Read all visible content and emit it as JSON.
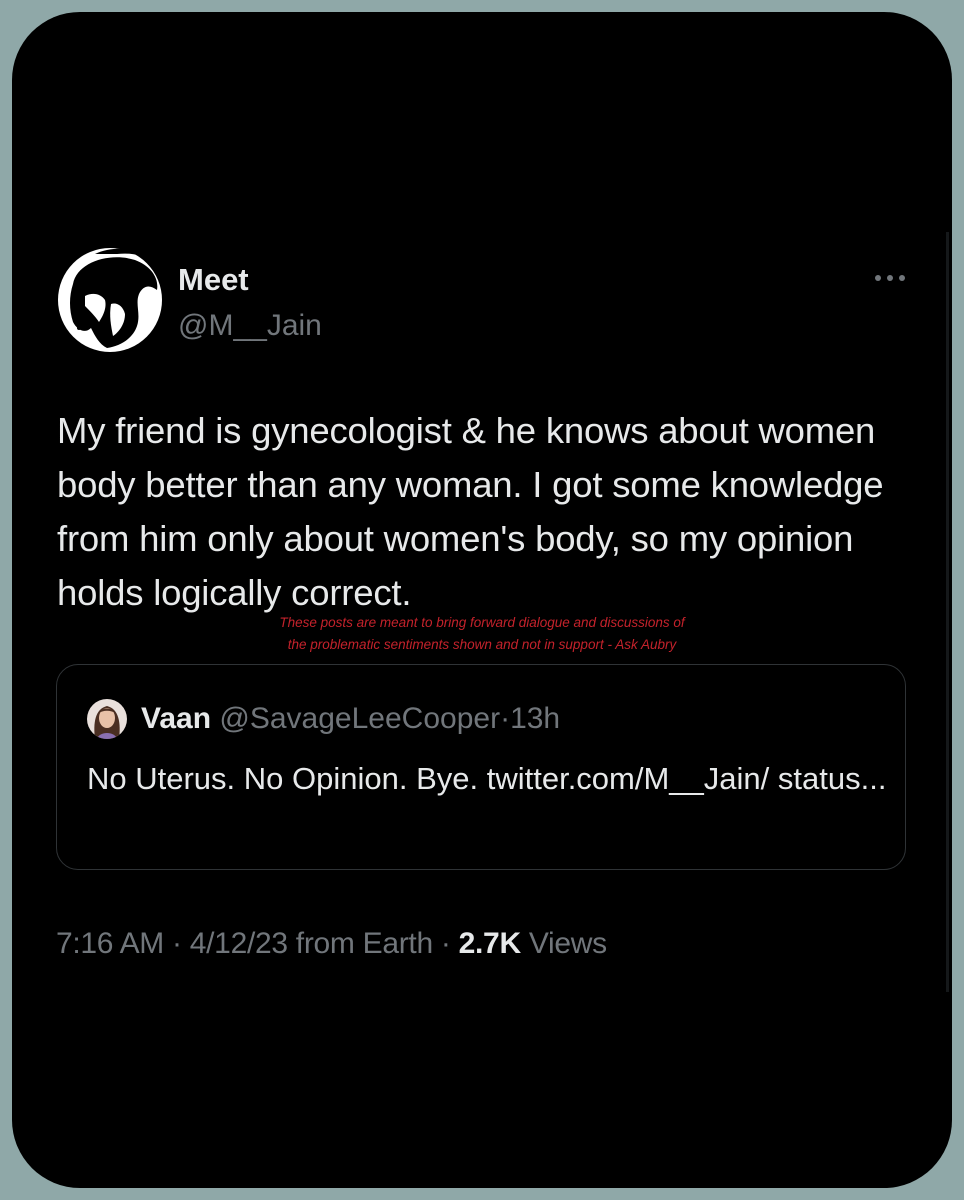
{
  "author": {
    "name": "Meet",
    "handle": "@M__Jain",
    "avatar_icon": "silhouette-avatar-icon"
  },
  "more_icon": "more-horizontal-icon",
  "tweet": {
    "text": "My friend is gynecologist & he knows about women body better than any woman. I got some knowledge from him only about women's body, so my opinion holds logically correct."
  },
  "disclaimer": {
    "line1": "These posts are meant to bring forward dialogue and discussions of",
    "line2": "the problematic sentiments shown and not in support - Ask Aubry"
  },
  "quoted_tweet": {
    "name": "Vaan",
    "handle": "@SavageLeeCooper",
    "separator": "·",
    "time": "13h",
    "text": "No Uterus. No Opinion. Bye. twitter.com/M__Jain/ status..."
  },
  "meta": {
    "time": "7:16 AM",
    "separator": "·",
    "date_source": "4/12/23 from Earth",
    "views_count": "2.7K",
    "views_label": "Views"
  },
  "colors": {
    "background": "#000000",
    "frame": "#8fa8a8",
    "primary_text": "#e7e9ea",
    "secondary_text": "#71767b",
    "border": "#2f3336",
    "disclaimer": "#c4222b"
  }
}
